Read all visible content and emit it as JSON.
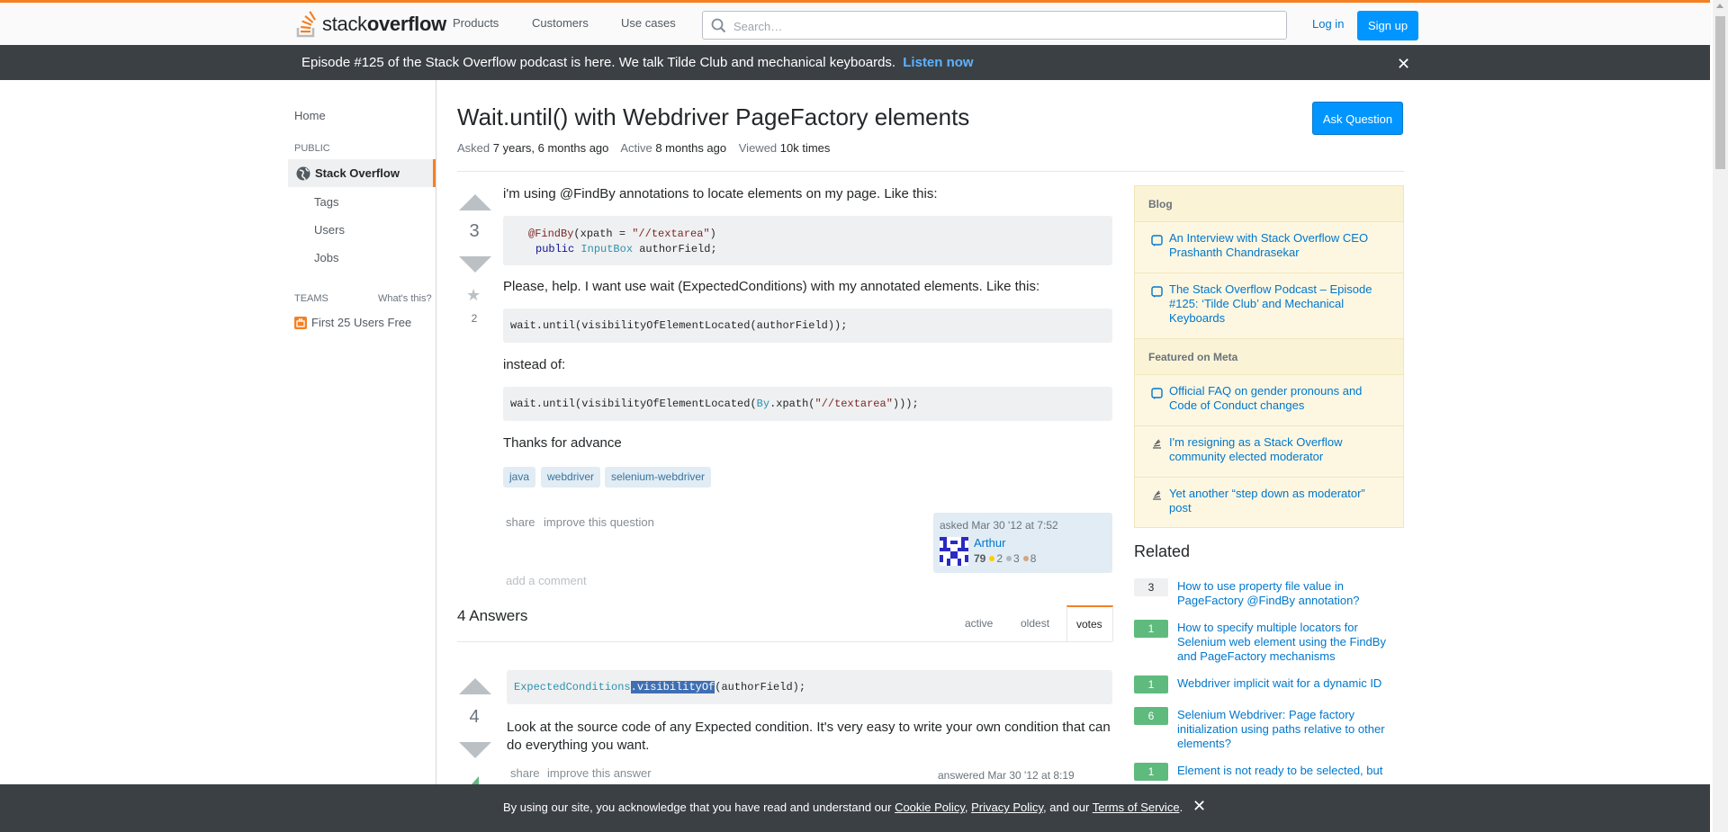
{
  "header": {
    "logo_text_a": "stack",
    "logo_text_b": "overflow",
    "nav": [
      "Products",
      "Customers",
      "Use cases"
    ],
    "search_placeholder": "Search…",
    "login_label": "Log in",
    "signup_label": "Sign up"
  },
  "banner": {
    "text": "Episode #125 of the Stack Overflow podcast is here. We talk Tilde Club and mechanical keyboards.",
    "link": "Listen now",
    "close": "✕"
  },
  "sidebar": {
    "home": "Home",
    "public": "PUBLIC",
    "stack_overflow": "Stack Overflow",
    "sub": [
      "Tags",
      "Users",
      "Jobs"
    ],
    "teams": "TEAMS",
    "whats_this": "What's this?",
    "first_users": "First 25 Users Free"
  },
  "question": {
    "title": "Wait.until() with Webdriver PageFactory elements",
    "asked_label": "Asked",
    "asked_value": "7 years, 6 months ago",
    "active_label": "Active",
    "active_value": "8 months ago",
    "viewed_label": "Viewed",
    "viewed_value": "10k times",
    "ask_button": "Ask Question",
    "votes": "3",
    "favorites": "2",
    "p1": "i'm using @FindBy annotations to locate elements on my page. Like this:",
    "code1_ann": "@FindBy",
    "code1_a": "(xpath = ",
    "code1_str": "\"//textarea\"",
    "code1_b": ")",
    "code1_kw": "public",
    "code1_type": "InputBox",
    "code1_c": "authorField;",
    "p2": "Please, help. I want use wait (ExpectedConditions) with my annotated elements. Like this:",
    "code2": "wait.until(visibilityOfElementLocated(authorField));",
    "p3": "instead of:",
    "code3_a": "wait.until(visibilityOfElementLocated(",
    "code3_type": "By",
    "code3_b": ".xpath(",
    "code3_str": "\"//textarea\"",
    "code3_c": ")));",
    "p4": "Thanks for advance",
    "tags": [
      "java",
      "webdriver",
      "selenium-webdriver"
    ],
    "share": "share",
    "improve": "improve this question",
    "user_asked": "asked Mar 30 '12 at 7:52",
    "user_name": "Arthur",
    "user_rep": "79",
    "gold": "2",
    "silver": "3",
    "bronze": "8",
    "add_comment": "add a comment"
  },
  "answers": {
    "header": "4 Answers",
    "tabs": [
      "active",
      "oldest",
      "votes"
    ],
    "a1_votes": "4",
    "a1_code_type": "ExpectedConditions",
    "a1_code_dot": ".",
    "a1_code_sel": "visibilityOf",
    "a1_code_rest": "(authorField);",
    "a1_text": "Look at the source code of any Expected condition. It's very easy to write your own condition that can do everything you want.",
    "a1_share": "share",
    "a1_improve": "improve this answer",
    "a1_answered": "answered Mar 30 '12 at 8:19"
  },
  "right": {
    "blog_header": "Blog",
    "blog_items": [
      "An Interview with Stack Overflow CEO Prashanth Chandrasekar",
      "The Stack Overflow Podcast – Episode #125: ‘Tilde Club’ and Mechanical Keyboards"
    ],
    "meta_header": "Featured on Meta",
    "meta_items": [
      "Official FAQ on gender pronouns and Code of Conduct changes",
      "I'm resigning as a Stack Overflow community elected moderator",
      "Yet another “step down as moderator” post"
    ],
    "related_header": "Related",
    "related": [
      {
        "count": "3",
        "title": "How to use property file value in PageFactory @FindBy annotation?"
      },
      {
        "count": "1",
        "title": "How to specify multiple locators for Selenium web element using the FindBy and PageFactory mechanisms"
      },
      {
        "count": "1",
        "title": "Webdriver implicit wait for a dynamic ID"
      },
      {
        "count": "6",
        "title": "Selenium Webdriver: Page factory initialization using paths relative to other elements?"
      },
      {
        "count": "1",
        "title": "Element is not ready to be selected, but"
      }
    ]
  },
  "cookie": {
    "text_a": "By using our site, you acknowledge that you have read and understand our ",
    "cookie_policy": "Cookie Policy",
    "sep1": ", ",
    "privacy_policy": "Privacy Policy",
    "sep2": ", and our ",
    "terms": "Terms of Service",
    "end": ".",
    "close": "✕"
  },
  "colors": {
    "accent": "#f48024",
    "primary_button": "#0095ff",
    "link": "#0077cc",
    "dark_bar": "#3b4045",
    "accepted_count": "#5fba7d"
  }
}
